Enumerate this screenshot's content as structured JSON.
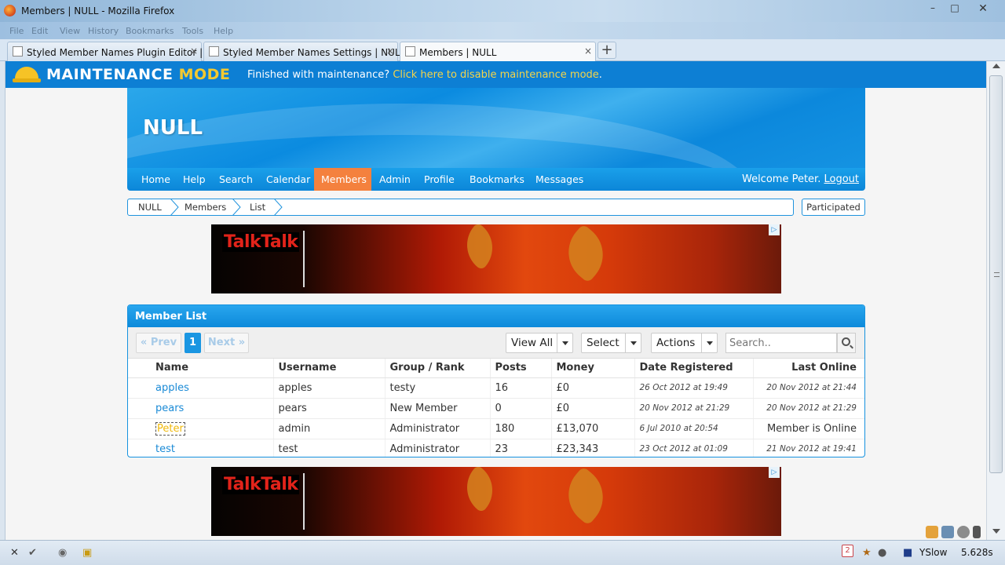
{
  "window": {
    "title": "Members | NULL - Mozilla Firefox",
    "min": "–",
    "max": "□",
    "close": "✕"
  },
  "menubar": [
    "File",
    "Edit",
    "View",
    "History",
    "Bookmarks",
    "Tools",
    "Help"
  ],
  "tabs": [
    {
      "label": "Styled Member Names Plugin Editor |...",
      "close": "×"
    },
    {
      "label": "Styled Member Names Settings | NULL",
      "close": "×"
    },
    {
      "label": "Members | NULL",
      "close": "×",
      "active": true
    }
  ],
  "new_tab": "+",
  "maintenance": {
    "title": "MAINTENANCE",
    "title_mode": "MODE",
    "text": "Finished with maintenance?",
    "link": "Click here to disable maintenance mode",
    "after": "."
  },
  "header": {
    "logo": "NULL"
  },
  "nav": {
    "items": [
      "Home",
      "Help",
      "Search",
      "Calendar",
      "Members",
      "Admin",
      "Profile",
      "Bookmarks",
      "Messages"
    ],
    "active": "Members",
    "welcome": "Welcome Peter.",
    "logout": "Logout"
  },
  "breadcrumb": [
    "NULL",
    "Members",
    "List"
  ],
  "participated": "Participated",
  "ad": {
    "brand": "TalkTalk",
    "adchoice": "▷"
  },
  "member_list": {
    "title": "Member List",
    "pager": {
      "prev": "« Prev",
      "current": "1",
      "next": "Next »"
    },
    "view_all": "View All",
    "select": "Select",
    "actions": "Actions",
    "search_placeholder": "Search..",
    "columns": [
      "Name",
      "Username",
      "Group / Rank",
      "Posts",
      "Money",
      "Date Registered",
      "Last Online"
    ],
    "rows": [
      {
        "name": "apples",
        "username": "apples",
        "group": "testy",
        "posts": "16",
        "money": "£0",
        "registered": "26 Oct 2012 at 19:49",
        "last": "20 Nov 2012 at 21:44"
      },
      {
        "name": "pears",
        "username": "pears",
        "group": "New Member",
        "posts": "0",
        "money": "£0",
        "registered": "20 Nov 2012 at 21:29",
        "last": "20 Nov 2012 at 21:29"
      },
      {
        "name": "Peter",
        "username": "admin",
        "group": "Administrator",
        "posts": "180",
        "money": "£13,070",
        "registered": "6 Jul 2010 at 20:54",
        "last": "Member is Online"
      },
      {
        "name": "test",
        "username": "test",
        "group": "Administrator",
        "posts": "23",
        "money": "£23,343",
        "registered": "23 Oct 2012 at 01:09",
        "last": "21 Nov 2012 at 19:41"
      }
    ]
  },
  "statusbar": {
    "close": "✕",
    "notification_count": "2",
    "yslow": "YSlow",
    "time": "5.628s"
  },
  "colors": {
    "maintenance_bar": "#0d7fd4",
    "mode_accent": "#f4c92f",
    "nav_active": "#f4813e",
    "link": "#1a8ad6",
    "styled_name": "#f0b90b"
  }
}
